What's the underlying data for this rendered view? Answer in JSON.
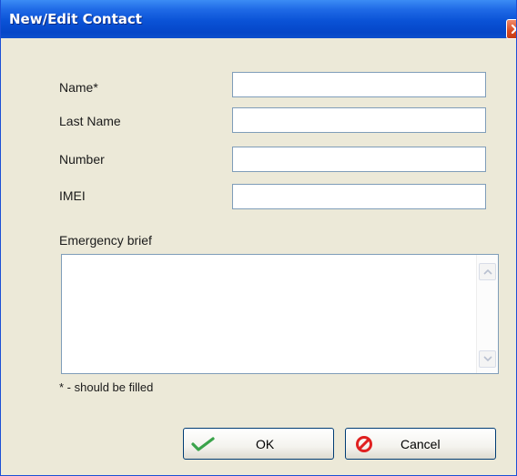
{
  "window": {
    "title": "New/Edit Contact",
    "close_icon": "close-icon"
  },
  "form": {
    "name_label": "Name*",
    "name_value": "",
    "last_name_label": "Last Name",
    "last_name_value": "",
    "number_label": "Number",
    "number_value": "",
    "imei_label": "IMEI",
    "imei_value": "",
    "emergency_label": "Emergency brief",
    "emergency_value": "",
    "required_note": "* - should be filled"
  },
  "buttons": {
    "ok_label": "OK",
    "ok_icon": "checkmark-icon",
    "cancel_label": "Cancel",
    "cancel_icon": "no-sign-icon"
  },
  "colors": {
    "titlebar": "#0a52d6",
    "dialog_bg": "#ece9d8",
    "field_border": "#7f9db9",
    "ok_icon": "#3aa34a",
    "cancel_icon": "#e02020"
  }
}
